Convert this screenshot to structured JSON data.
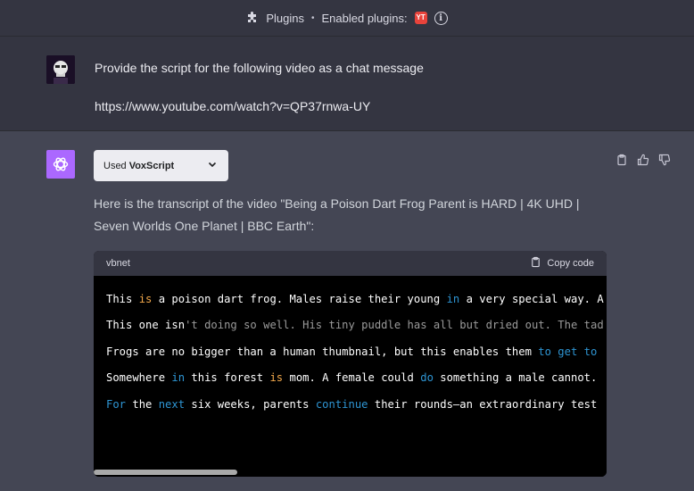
{
  "topbar": {
    "plugins_label": "Plugins",
    "separator": "•",
    "enabled_label": "Enabled plugins:",
    "plugin_badge": "YT"
  },
  "user_message": {
    "line1": "Provide the script for the following video as a chat message",
    "line2": "https://www.youtube.com/watch?v=QP37rnwa-UY"
  },
  "assistant": {
    "used_prefix": "Used",
    "used_plugin": "VoxScript",
    "intro_line1": "Here is the transcript of the video \"Being a Poison Dart Frog Parent is HARD | 4K UHD |",
    "intro_line2": "Seven Worlds One Planet | BBC Earth\":"
  },
  "code": {
    "language": "vbnet",
    "copy_label": "Copy code",
    "lines": [
      [
        {
          "t": "This ",
          "c": ""
        },
        {
          "t": "is",
          "c": "k-orange"
        },
        {
          "t": " a poison dart frog. Males raise their young ",
          "c": ""
        },
        {
          "t": "in",
          "c": "k-blue"
        },
        {
          "t": " a very special way. A",
          "c": ""
        }
      ],
      [
        {
          "t": "This one isn",
          "c": ""
        },
        {
          "t": "'t doing so well. His tiny puddle has all but dried out. The tad",
          "c": "k-gray"
        }
      ],
      [
        {
          "t": "Frogs are no bigger than a human thumbnail, but this enables them ",
          "c": ""
        },
        {
          "t": "to get to",
          "c": "k-blue"
        }
      ],
      [
        {
          "t": "Somewhere ",
          "c": ""
        },
        {
          "t": "in",
          "c": "k-blue"
        },
        {
          "t": " this forest ",
          "c": ""
        },
        {
          "t": "is",
          "c": "k-orange"
        },
        {
          "t": " mom. A female could ",
          "c": ""
        },
        {
          "t": "do",
          "c": "k-blue"
        },
        {
          "t": " something a male cannot.",
          "c": ""
        }
      ],
      [
        {
          "t": "For",
          "c": "k-blue"
        },
        {
          "t": " the ",
          "c": ""
        },
        {
          "t": "next",
          "c": "k-blue"
        },
        {
          "t": " six weeks, parents ",
          "c": ""
        },
        {
          "t": "continue",
          "c": "k-blue"
        },
        {
          "t": " their rounds—an extraordinary test",
          "c": ""
        }
      ]
    ]
  },
  "colors": {
    "page_bg": "#444654",
    "user_bg": "#343541",
    "assistant_avatar": "#ab68ff",
    "code_keyword_blue": "#2e95d3",
    "code_keyword_orange": "#f2a84b"
  }
}
